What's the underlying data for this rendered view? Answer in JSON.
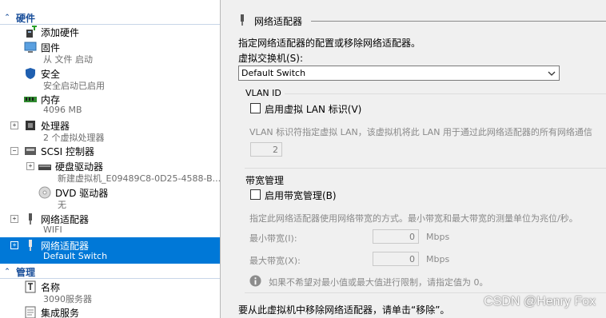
{
  "left": {
    "hardware_header": "硬件",
    "manage_header": "管理",
    "items": [
      {
        "label": "添加硬件"
      },
      {
        "label": "固件",
        "sub": "从 文件 启动"
      },
      {
        "label": "安全",
        "sub": "安全启动已启用"
      },
      {
        "label": "内存",
        "sub": "4096 MB"
      },
      {
        "label": "处理器",
        "sub": "2 个虚拟处理器"
      },
      {
        "label": "SCSI 控制器"
      },
      {
        "label": "硬盘驱动器",
        "sub": "新建虚拟机_E09489C8-0D25-4588-B..."
      },
      {
        "label": "DVD 驱动器",
        "sub": "无"
      },
      {
        "label": "网络适配器",
        "sub": "WIFI"
      },
      {
        "label": "网络适配器",
        "sub": "Default Switch"
      },
      {
        "label": "名称",
        "sub": "3090服务器"
      },
      {
        "label": "集成服务"
      }
    ]
  },
  "right": {
    "section_title": "网络适配器",
    "description": "指定网络适配器的配置或移除网络适配器。",
    "switch_label": "虚拟交换机(S):",
    "switch_value": "Default Switch",
    "vlan_group": "VLAN ID",
    "vlan_checkbox": "启用虚拟 LAN 标识(V)",
    "vlan_desc": "VLAN 标识符指定虚拟 LAN，该虚拟机将此 LAN 用于通过此网络适配器的所有网络通信",
    "vlan_value": "2",
    "bw_group": "带宽管理",
    "bw_checkbox": "启用带宽管理(B)",
    "bw_desc": "指定此网络适配器使用网络带宽的方式。最小带宽和最大带宽的测量单位为兆位/秒。",
    "min_label": "最小带宽(I):",
    "min_value": "0",
    "max_label": "最大带宽(X):",
    "max_value": "0",
    "unit": "Mbps",
    "info_text": "如果不希望对最小值或最大值进行限制，请指定值为 0。",
    "remove_text": "要从此虚拟机中移除网络适配器，请单击“移除”。"
  },
  "watermark": "CSDN @Henry Fox",
  "colors": {
    "selection": "#0078d7",
    "section_header": "#1a4f9a"
  }
}
